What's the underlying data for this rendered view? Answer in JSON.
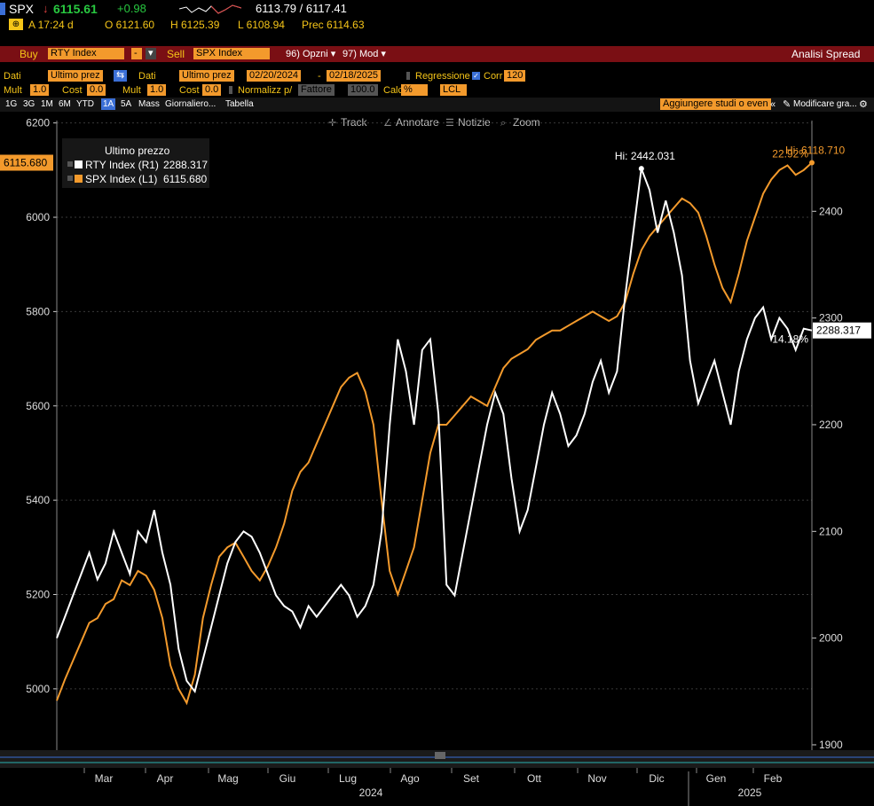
{
  "header": {
    "ticker": "SPX",
    "price": "6115.61",
    "change": "+0.98",
    "bid_ask": "6113.79 / 6117.41",
    "time_label": "A 17:24 d",
    "open": "O 6121.60",
    "high": "H 6125.39",
    "low": "L 6108.94",
    "prev": "Prec 6114.63"
  },
  "spread_bar": {
    "buy_label": "Buy",
    "buy_value": "RTY Index",
    "sell_label": "Sell",
    "sell_value": "SPX Index",
    "options": "96) Opzni ▾",
    "mod": "97) Mod ▾",
    "title": "Analisi Spread"
  },
  "controls": {
    "dati1": "Dati",
    "ultimo1": "Ultimo prez",
    "dati2": "Dati",
    "ultimo2": "Ultimo prez",
    "date_from": "02/20/2024",
    "date_to": "02/18/2025",
    "regressione": "Regressione",
    "corr": "Corr",
    "corr_val": "120",
    "mult1": "Mult",
    "mult1_val": "1.0",
    "cost1": "Cost",
    "cost1_val": "0.0",
    "mult2": "Mult",
    "mult2_val": "1.0",
    "cost2": "Cost",
    "cost2_val": "0.0",
    "normalizz": "Normalizz p/",
    "fattore": "Fattore",
    "fattore_val": "100.0",
    "calc": "Calc",
    "calc_val": "%",
    "lcl": "LCL"
  },
  "ranges": [
    "1G",
    "3G",
    "1M",
    "6M",
    "YTD",
    "1A",
    "5A",
    "Mass",
    "Giornaliero...",
    "Tabella"
  ],
  "active_range": "1A",
  "studies_btn": "Aggiungere studi o even",
  "modify_btn": "Modificare gra...",
  "toolbar": {
    "track": "Track",
    "annotate": "Annotare",
    "news": "Notizie",
    "zoom": "Zoom"
  },
  "chart_data": {
    "type": "line",
    "legend_title": "Ultimo prezzo",
    "series": [
      {
        "name": "RTY Index (R1)",
        "last": "2288.317",
        "axis": "right",
        "color": "#ffffff",
        "high_label": "Hi: 2442.031",
        "change_label": "14.18%",
        "values": [
          2000,
          2020,
          2040,
          2060,
          2080,
          2055,
          2070,
          2100,
          2080,
          2060,
          2100,
          2090,
          2120,
          2080,
          2050,
          1990,
          1960,
          1950,
          1980,
          2010,
          2040,
          2070,
          2090,
          2100,
          2095,
          2080,
          2060,
          2040,
          2030,
          2025,
          2010,
          2030,
          2020,
          2030,
          2040,
          2050,
          2040,
          2020,
          2030,
          2050,
          2100,
          2200,
          2280,
          2250,
          2200,
          2270,
          2280,
          2210,
          2050,
          2040,
          2080,
          2120,
          2160,
          2200,
          2230,
          2210,
          2150,
          2100,
          2120,
          2160,
          2200,
          2230,
          2210,
          2180,
          2190,
          2210,
          2240,
          2260,
          2230,
          2250,
          2320,
          2380,
          2440,
          2420,
          2380,
          2410,
          2380,
          2340,
          2260,
          2220,
          2240,
          2260,
          2230,
          2200,
          2250,
          2280,
          2300,
          2310,
          2280,
          2300,
          2290,
          2270,
          2290,
          2288.317
        ]
      },
      {
        "name": "SPX Index (L1)",
        "last": "6115.680",
        "axis": "left",
        "color": "#f39a2c",
        "high_label": "Hi: 6118.710",
        "change_label": "22.92%",
        "values": [
          4975,
          5020,
          5060,
          5100,
          5140,
          5150,
          5180,
          5190,
          5230,
          5220,
          5250,
          5240,
          5210,
          5150,
          5050,
          5000,
          4970,
          5030,
          5150,
          5220,
          5280,
          5300,
          5310,
          5280,
          5250,
          5230,
          5260,
          5300,
          5350,
          5420,
          5460,
          5480,
          5520,
          5560,
          5600,
          5640,
          5660,
          5670,
          5630,
          5560,
          5400,
          5250,
          5200,
          5250,
          5300,
          5400,
          5500,
          5560,
          5560,
          5580,
          5600,
          5620,
          5610,
          5600,
          5640,
          5680,
          5700,
          5710,
          5720,
          5740,
          5750,
          5760,
          5760,
          5770,
          5780,
          5790,
          5800,
          5790,
          5780,
          5790,
          5820,
          5880,
          5930,
          5960,
          5980,
          6000,
          6020,
          6040,
          6030,
          6010,
          5960,
          5900,
          5850,
          5820,
          5880,
          5950,
          6000,
          6050,
          6080,
          6100,
          6110,
          6090,
          6100,
          6115.68
        ]
      }
    ],
    "x_months": [
      "Mar",
      "Apr",
      "Mag",
      "Giu",
      "Lug",
      "Ago",
      "Set",
      "Ott",
      "Nov",
      "Dic",
      "Gen",
      "Feb"
    ],
    "x_years": [
      "2024",
      "2025"
    ],
    "left_ticks": [
      5000,
      5200,
      5400,
      5600,
      5800,
      6000,
      6200
    ],
    "left_ylim": [
      4870,
      6205
    ],
    "right_ticks": [
      1900,
      2000,
      2100,
      2200,
      2300,
      2400
    ],
    "right_ylim": [
      1895,
      2485
    ],
    "grid": true
  }
}
